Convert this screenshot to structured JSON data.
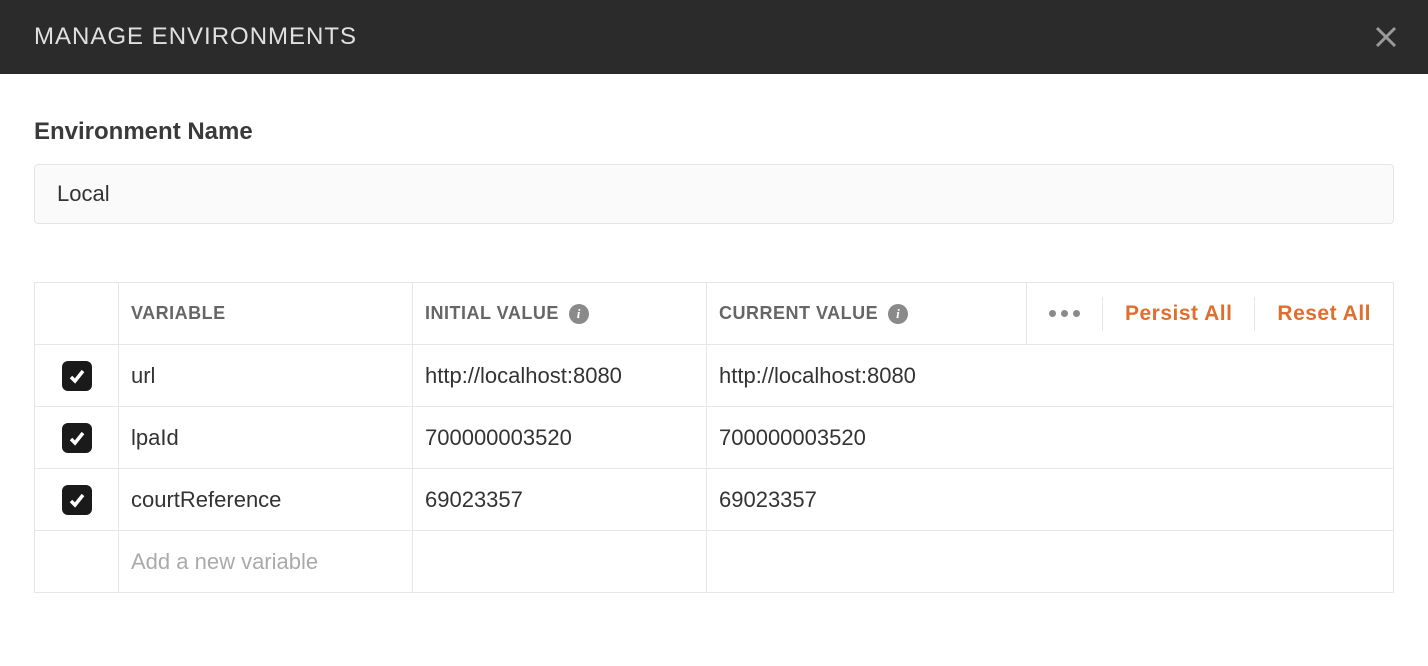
{
  "header": {
    "title": "MANAGE ENVIRONMENTS"
  },
  "form": {
    "section_label": "Environment Name",
    "env_name_value": "Local"
  },
  "table": {
    "headers": {
      "variable": "VARIABLE",
      "initial_value": "INITIAL VALUE",
      "current_value": "CURRENT VALUE"
    },
    "actions": {
      "persist_all": "Persist All",
      "reset_all": "Reset All"
    },
    "rows": [
      {
        "enabled": true,
        "variable": "url",
        "initial": "http://localhost:8080",
        "current": "http://localhost:8080"
      },
      {
        "enabled": true,
        "variable": "lpaId",
        "initial": "700000003520",
        "current": "700000003520"
      },
      {
        "enabled": true,
        "variable": "courtReference",
        "initial": "69023357",
        "current": "69023357"
      }
    ],
    "new_row_placeholder": "Add a new variable"
  },
  "icons": {
    "close": "close-icon",
    "info": "info-icon",
    "more": "more-icon",
    "check": "check-icon"
  }
}
